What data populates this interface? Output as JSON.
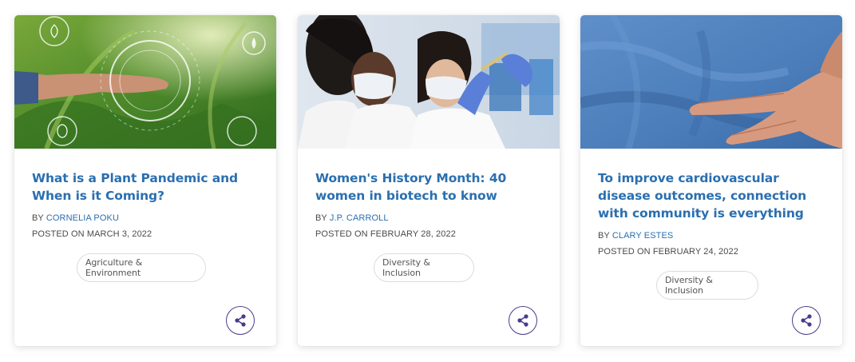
{
  "cards": [
    {
      "image_alt": "Hands over crops with agriculture icons overlay",
      "title": "What is a Plant Pandemic and When is it Coming?",
      "by_prefix": "BY",
      "author": "CORNELIA POKU",
      "posted_label": "POSTED ON MARCH 3, 2022",
      "tag": "Agriculture & Environment",
      "share_icon": "share-icon"
    },
    {
      "image_alt": "Two women scientists in lab coats and masks",
      "title": "Women's History Month: 40 women in biotech to know",
      "by_prefix": "BY",
      "author": "J.P. CARROLL",
      "posted_label": "POSTED ON FEBRUARY 28, 2022",
      "tag": "Diversity & Inclusion",
      "share_icon": "share-icon"
    },
    {
      "image_alt": "Hand on chest over blue shirt",
      "title": "To improve cardiovascular disease outcomes, connection with community is everything",
      "by_prefix": "BY",
      "author": "CLARY ESTES",
      "posted_label": "POSTED ON FEBRUARY 24, 2022",
      "tag": "Diversity & Inclusion",
      "share_icon": "share-icon"
    }
  ],
  "colors": {
    "title": "#2a6fb0",
    "share_border": "#4b3a8c",
    "tag_border": "#dcdcdc"
  }
}
